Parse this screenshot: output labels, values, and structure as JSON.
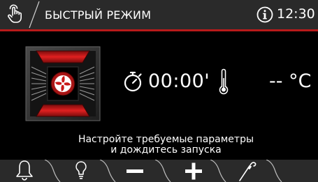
{
  "header": {
    "title": "БЫСТРЫЙ РЕЖИМ",
    "clock": "12:30",
    "mode_icon": "touch-hand-icon",
    "info_icon": "info-icon"
  },
  "main": {
    "mode_icon": "fan-convection-icon",
    "timer_icon": "stopwatch-icon",
    "timer_value": "00:00'",
    "temperature_icon": "thermometer-icon",
    "temperature_value": "-- °C"
  },
  "message": {
    "line1": "Настройте требуемые параметры",
    "line2": "и дождитесь запуска"
  },
  "bottom_bar": {
    "buttons": [
      {
        "icon": "bell-icon"
      },
      {
        "icon": "light-bulb-icon"
      },
      {
        "icon": "minus-icon"
      },
      {
        "icon": "plus-icon"
      },
      {
        "icon": "meat-probe-icon"
      }
    ]
  },
  "colors": {
    "accent": "#b81a1a",
    "bar_background": "#2a2a2a",
    "background": "#000000",
    "text": "#ffffff"
  }
}
